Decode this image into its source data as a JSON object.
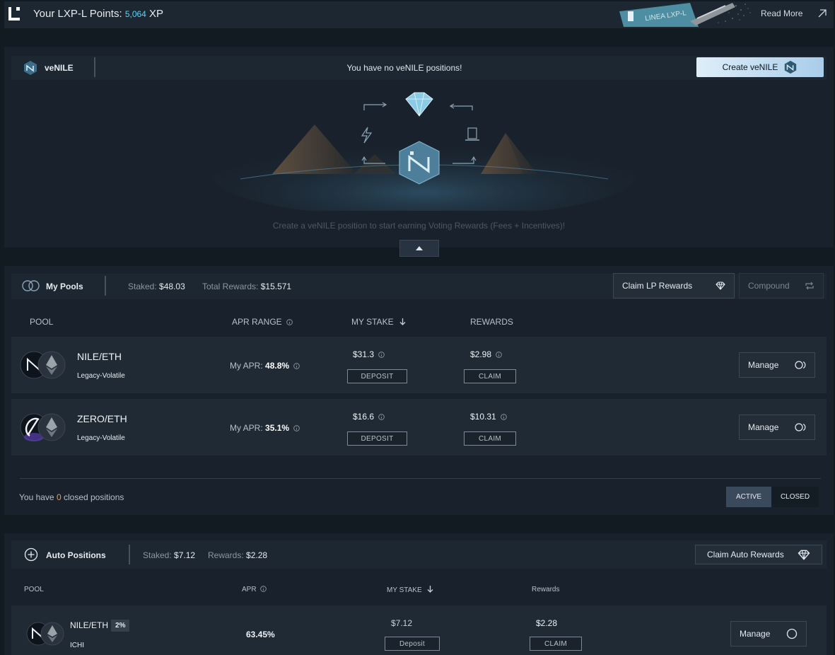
{
  "topbar": {
    "points_label": "Your LXP-L Points:",
    "points_value": "5,064",
    "points_unit": "XP",
    "banner_text": "LINEA LXP-L",
    "read_more": "Read More"
  },
  "venile": {
    "title": "veNILE",
    "empty_message": "You have no veNILE positions!",
    "create_button": "Create veNILE",
    "hero_text": "Create a veNILE position to start earning Voting Rewards (Fees + Incentives)!"
  },
  "my_pools": {
    "title": "My Pools",
    "staked_label": "Staked:",
    "staked_value": "$48.03",
    "rewards_label": "Total Rewards:",
    "rewards_value": "$15.571",
    "claim_button": "Claim LP Rewards",
    "compound_button": "Compound",
    "columns": [
      "POOL",
      "APR RANGE",
      "MY STAKE",
      "REWARDS"
    ],
    "rows": [
      {
        "name": "NILE/ETH",
        "type": "Legacy-Volatile",
        "apr_label": "My APR:",
        "apr": "48.8%",
        "stake": "$31.3",
        "deposit": "DEPOSIT",
        "rewards": "$2.98",
        "claim": "CLAIM",
        "manage": "Manage"
      },
      {
        "name": "ZERO/ETH",
        "type": "Legacy-Volatile",
        "apr_label": "My APR:",
        "apr": "35.1%",
        "stake": "$16.6",
        "deposit": "DEPOSIT",
        "rewards": "$10.31",
        "claim": "CLAIM",
        "manage": "Manage"
      }
    ],
    "closed_prefix": "You have",
    "closed_count": "0",
    "closed_suffix": "closed positions",
    "toggle_active": "ACTIVE",
    "toggle_closed": "CLOSED"
  },
  "auto_positions": {
    "title": "Auto Positions",
    "staked_label": "Staked:",
    "staked_value": "$7.12",
    "rewards_label": "Rewards:",
    "rewards_value": "$2.28",
    "claim_button": "Claim Auto Rewards",
    "columns": [
      "POOL",
      "APR",
      "MY STAKE",
      "Rewards"
    ],
    "row": {
      "name": "NILE/ETH",
      "fee": "2%",
      "provider": "ICHI",
      "apr": "63.45%",
      "stake": "$7.12",
      "deposit": "Deposit",
      "rewards": "$2.28",
      "claim": "CLAIM",
      "manage": "Manage"
    }
  },
  "colors": {
    "accent_cyan": "#5fd2f4",
    "closed_count": "#e8a14a",
    "background": "#121a22",
    "panel": "#19222c"
  }
}
